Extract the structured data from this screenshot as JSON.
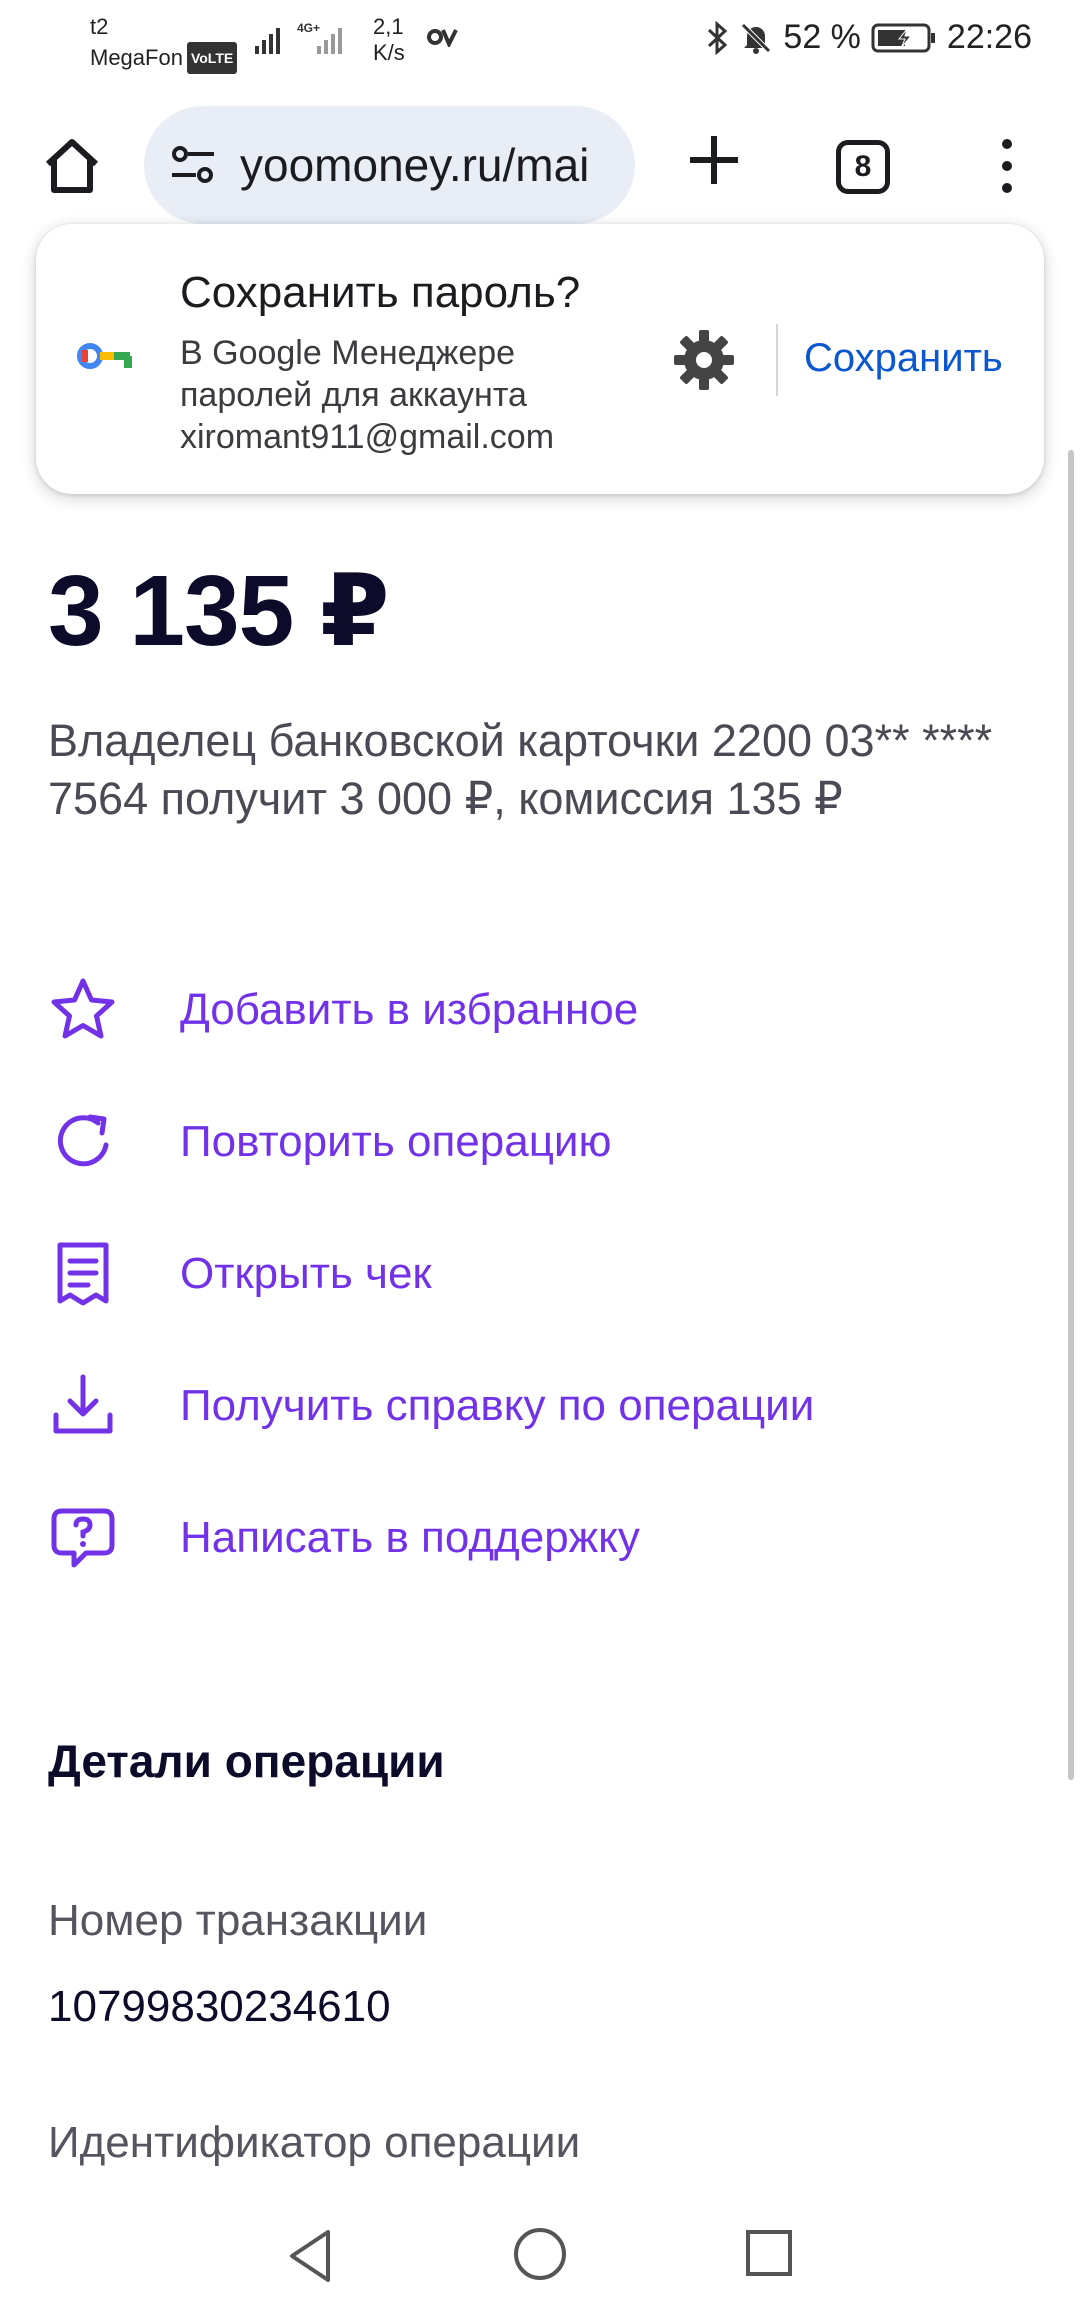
{
  "statusbar": {
    "carrier": "t2",
    "carrier2": "MegaFon",
    "volte": "VoLTE",
    "network": "4G+",
    "speed_value": "2,1",
    "speed_unit": "K/s",
    "battery": "52 %",
    "time": "22:26"
  },
  "browser": {
    "url": "yoomoney.ru/mai",
    "tab_count": "8"
  },
  "password_prompt": {
    "title": "Сохранить пароль?",
    "description": "В Google Менеджере паролей для аккаунта xiromant911@gmail.com",
    "save_label": "Сохранить"
  },
  "operation": {
    "amount": "3 135 ₽",
    "description": "Владелец банковской карточки 2200 03** **** 7564 получит 3 000 ₽, комиссия 135 ₽"
  },
  "actions": [
    {
      "label": "Добавить в избранное",
      "icon": "star-icon"
    },
    {
      "label": "Повторить операцию",
      "icon": "repeat-icon"
    },
    {
      "label": "Открыть чек",
      "icon": "receipt-icon"
    },
    {
      "label": "Получить справку по операции",
      "icon": "download-icon"
    },
    {
      "label": "Написать в поддержку",
      "icon": "support-chat-icon"
    }
  ],
  "details": {
    "title": "Детали операции",
    "transaction_label": "Номер транзакции",
    "transaction_value": "10799830234610",
    "operation_id_label": "Идентификатор операции"
  },
  "colors": {
    "accent": "#7233e8",
    "save_blue": "#0b57d0",
    "amount_text": "#0c0b29"
  }
}
